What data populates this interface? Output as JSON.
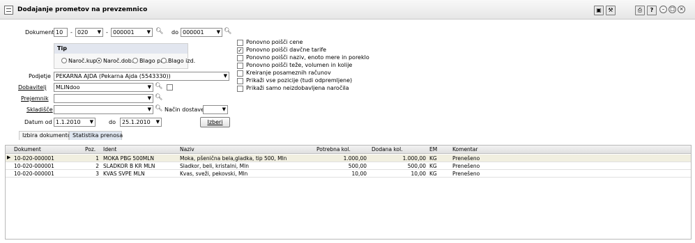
{
  "window": {
    "title": "Dodajanje prometov na prevzemnico"
  },
  "form": {
    "dokument": {
      "label": "Dokument",
      "part1": "10",
      "part2": "020",
      "part3": "000001",
      "do_label": "do",
      "do_value": "000001"
    },
    "tip": {
      "label": "Tip",
      "options": [
        "Naroč.kup.",
        "Naroč.dob.",
        "Blago pre.",
        "Blago izd."
      ],
      "selected": 1
    },
    "podjetje": {
      "label": "Podjetje",
      "value": "PEKARNA AJDA (Pekarna Ajda (5543330))"
    },
    "dobavitelj": {
      "label": "Dobavitelj",
      "value": "MLINdoo"
    },
    "prejemnik": {
      "label": "Prejemnik",
      "value": ""
    },
    "skladisce": {
      "label": "Skladišče",
      "value": ""
    },
    "nacin_dostave": {
      "label": "Način dostave",
      "value": ""
    },
    "datum": {
      "od_label": "Datum od",
      "od_value": "1.1.2010",
      "do_label": "do",
      "do_value": "25.1.2010"
    },
    "izberi_label": "Izberi"
  },
  "options": [
    {
      "label": "Ponovno poišči cene",
      "checked": false
    },
    {
      "label": "Ponovno poišči davčne tarife",
      "checked": true
    },
    {
      "label": "Ponovno poišči naziv, enoto mere in poreklo",
      "checked": false
    },
    {
      "label": "Ponovno poišči teže, volumen in kolije",
      "checked": false
    },
    {
      "label": "Kreiranje posameznih računov",
      "checked": false
    },
    {
      "label": "Prikaži vse pozicije (tudi odpremljene)",
      "checked": false
    },
    {
      "label": "Prikaži samo neizdobavljena naročila",
      "checked": false
    }
  ],
  "tabs": [
    {
      "label": "Izbira dokumentov",
      "active": false
    },
    {
      "label": "Statistika prenosa",
      "active": true
    }
  ],
  "table": {
    "columns": [
      "Dokument",
      "Poz.",
      "Ident",
      "Naziv",
      "Potrebna kol.",
      "Dodana kol.",
      "EM",
      "Komentar"
    ],
    "rows": [
      [
        "10-020-000001",
        "1",
        "MOKA PBG 500MLN",
        "Moka, pšenična bela,gladka, tip 500, Mln",
        "1.000,00",
        "1.000,00",
        "KG",
        "Prenešeno"
      ],
      [
        "10-020-000001",
        "2",
        "SLADKOR B KR MLN",
        "Sladkor, beli, kristalni, Mln",
        "500,00",
        "500,00",
        "KG",
        "Prenešeno"
      ],
      [
        "10-020-000001",
        "3",
        "KVAS SVPE MLN",
        "Kvas, sveži, pekovski, Mln",
        "10,00",
        "10,00",
        "KG",
        "Prenešeno"
      ]
    ]
  },
  "colors": {
    "selected_row": "#f1efe0",
    "tab_active": "#dfe6f0",
    "tip_header": "#e2e6ef"
  }
}
